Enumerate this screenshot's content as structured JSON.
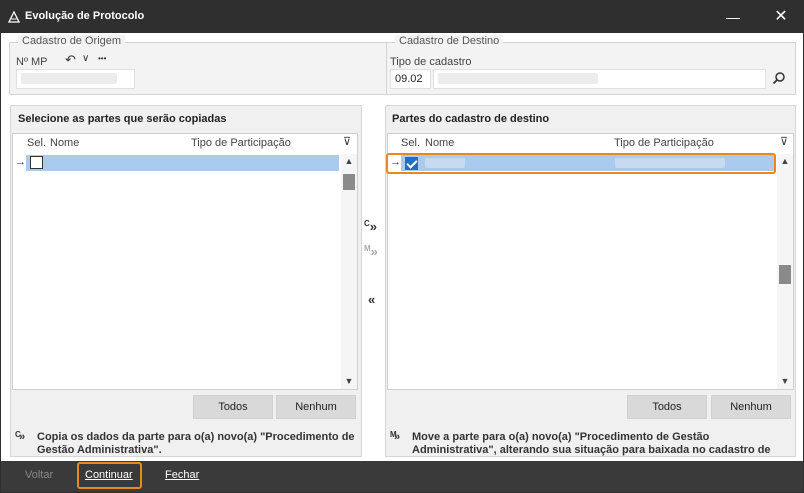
{
  "window": {
    "title": "Evolução de  Protocolo",
    "minimize_icon": "minimize-icon",
    "close_icon": "close-icon"
  },
  "origem": {
    "legend": "Cadastro de Origem",
    "mp_label": "Nº MP",
    "undo_icon": "undo-icon",
    "chevron_icon": "chevron-down-icon",
    "more_label": "•••"
  },
  "destino": {
    "legend": "Cadastro de Destino",
    "tipo_label": "Tipo de cadastro",
    "tipo_code": "09.02",
    "search_icon": "search-icon"
  },
  "left_panel": {
    "title": "Selecione as partes que serão copiadas",
    "columns": [
      "Sel.",
      "Nome",
      "Tipo de Participação"
    ],
    "btn_todos": "Todos",
    "btn_nenhum": "Nenhum"
  },
  "right_panel": {
    "title": "Partes do cadastro de destino",
    "columns": [
      "Sel.",
      "Nome",
      "Tipo de Participação"
    ],
    "btn_todos": "Todos",
    "btn_nenhum": "Nenhum"
  },
  "mid_buttons": {
    "copy_label": "C",
    "move_label": "M"
  },
  "notes": {
    "copy_key": "C",
    "copy_text": "Copia os dados da parte para o(a) novo(a) \"Procedimento de Gestão Administrativa\".",
    "move_key": "M",
    "move_text": "Move a parte para o(a) novo(a) \"Procedimento de Gestão Administrativa\", alterando sua situação para baixada no cadastro de"
  },
  "footer": {
    "voltar": "Voltar",
    "continuar": "Continuar",
    "fechar": "Fechar"
  },
  "colors": {
    "titlebar": "#2f2f2f",
    "highlight": "#e88a1a",
    "selected_row": "#aacbf0",
    "check": "#1f6fc8"
  }
}
